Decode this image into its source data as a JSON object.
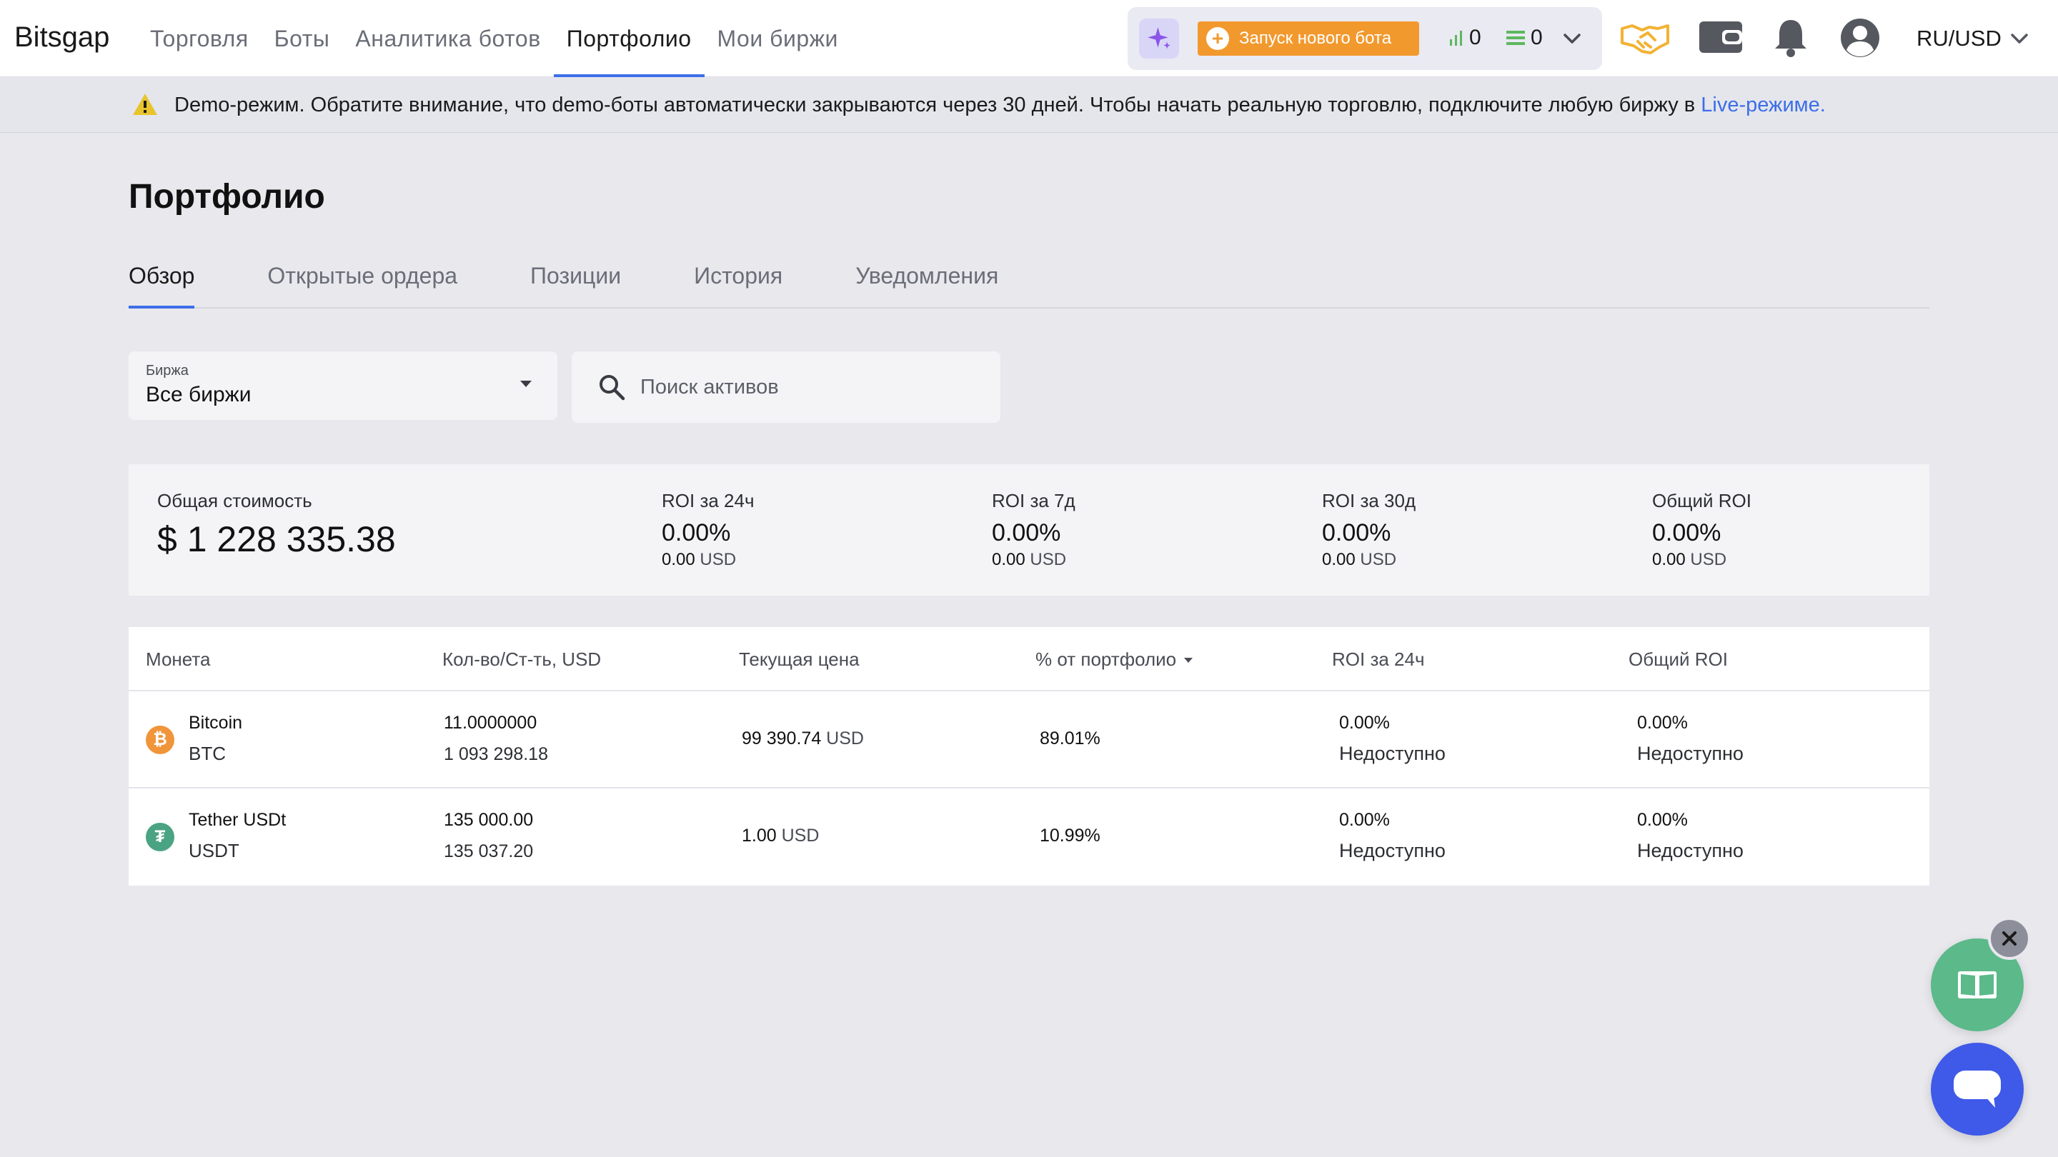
{
  "header": {
    "brand": "Bitsgap",
    "nav": [
      "Торговля",
      "Боты",
      "Аналитика ботов",
      "Портфолио",
      "Мои биржи"
    ],
    "active_nav": "Портфолио",
    "launch_bot_label": "Запуск нового бота",
    "active_bots_count": "0",
    "active_orders_count": "0",
    "locale": "RU/USD"
  },
  "banner": {
    "text": "Demo-режим. Обратите внимание, что demo-боты автоматически закрываются через 30 дней. Чтобы начать реальную торговлю, подключите любую биржу в ",
    "link": "Live-режиме."
  },
  "page": {
    "title": "Портфолио",
    "tabs": [
      "Обзор",
      "Открытые ордера",
      "Позиции",
      "История",
      "Уведомления"
    ],
    "active_tab": "Обзор"
  },
  "filters": {
    "exchange_label": "Биржа",
    "exchange_value": "Все биржи",
    "search_placeholder": "Поиск активов"
  },
  "summary": {
    "total_label": "Общая стоимость",
    "total_value": "$ 1 228 335.38",
    "roi": [
      {
        "label": "ROI за 24ч",
        "pct": "0.00%",
        "usd": "0.00",
        "currency": "USD"
      },
      {
        "label": "ROI за 7д",
        "pct": "0.00%",
        "usd": "0.00",
        "currency": "USD"
      },
      {
        "label": "ROI за 30д",
        "pct": "0.00%",
        "usd": "0.00",
        "currency": "USD"
      },
      {
        "label": "Общий ROI",
        "pct": "0.00%",
        "usd": "0.00",
        "currency": "USD"
      }
    ]
  },
  "table": {
    "headers": [
      "Монета",
      "Кол-во/Ст-ть, USD",
      "Текущая цена",
      "% от портфолио",
      "ROI за 24ч",
      "Общий ROI"
    ],
    "sorted_by": "% от портфолио",
    "rows": [
      {
        "name": "Bitcoin",
        "symbol": "BTC",
        "icon": "bitcoin-icon",
        "icon_color": "#f0953a",
        "qty": "11.0000000",
        "value": "1 093 298.18",
        "price": "99 390.74",
        "price_currency": "USD",
        "share": "89.01%",
        "roi24": "0.00%",
        "roi24_status": "Недоступно",
        "roi_total": "0.00%",
        "roi_total_status": "Недоступно"
      },
      {
        "name": "Tether USDt",
        "symbol": "USDT",
        "icon": "tether-icon",
        "icon_color": "#4aa383",
        "qty": "135 000.00",
        "value": "135 037.20",
        "price": "1.00",
        "price_currency": "USD",
        "share": "10.99%",
        "roi24": "0.00%",
        "roi24_status": "Недоступно",
        "roi_total": "0.00%",
        "roi_total_status": "Недоступно"
      }
    ]
  },
  "colors": {
    "accent": "#3d6ee8",
    "launch_button": "#f2992e",
    "guide_fab": "#5bb98a",
    "chat_fab": "#3f5ae8"
  }
}
